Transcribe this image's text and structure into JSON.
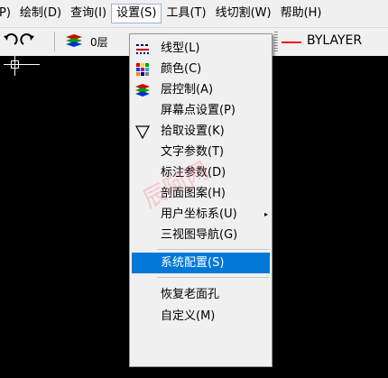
{
  "menubar": {
    "items": [
      "P)",
      "绘制(D)",
      "查询(I)",
      "设置(S)",
      "工具(T)",
      "线切割(W)",
      "帮助(H)"
    ]
  },
  "toolbar": {
    "layer_name": "0层",
    "linetype": "BYLAYER"
  },
  "dropdown": {
    "items": [
      "线型(L)",
      "颜色(C)",
      "层控制(A)",
      "屏幕点设置(P)",
      "拾取设置(K)",
      "文字参数(T)",
      "标注参数(D)",
      "剖面图案(H)",
      "用户坐标系(U)",
      "三视图导航(G)",
      "系统配置(S)",
      "恢复老面孔",
      "自定义(M)"
    ],
    "submenu_arrow": "▸",
    "highlighted": "系统配置(S)"
  },
  "watermark": "辰阿网",
  "colors": {
    "highlight": "#0078d7",
    "linetype_swatch": "#ff0000"
  }
}
